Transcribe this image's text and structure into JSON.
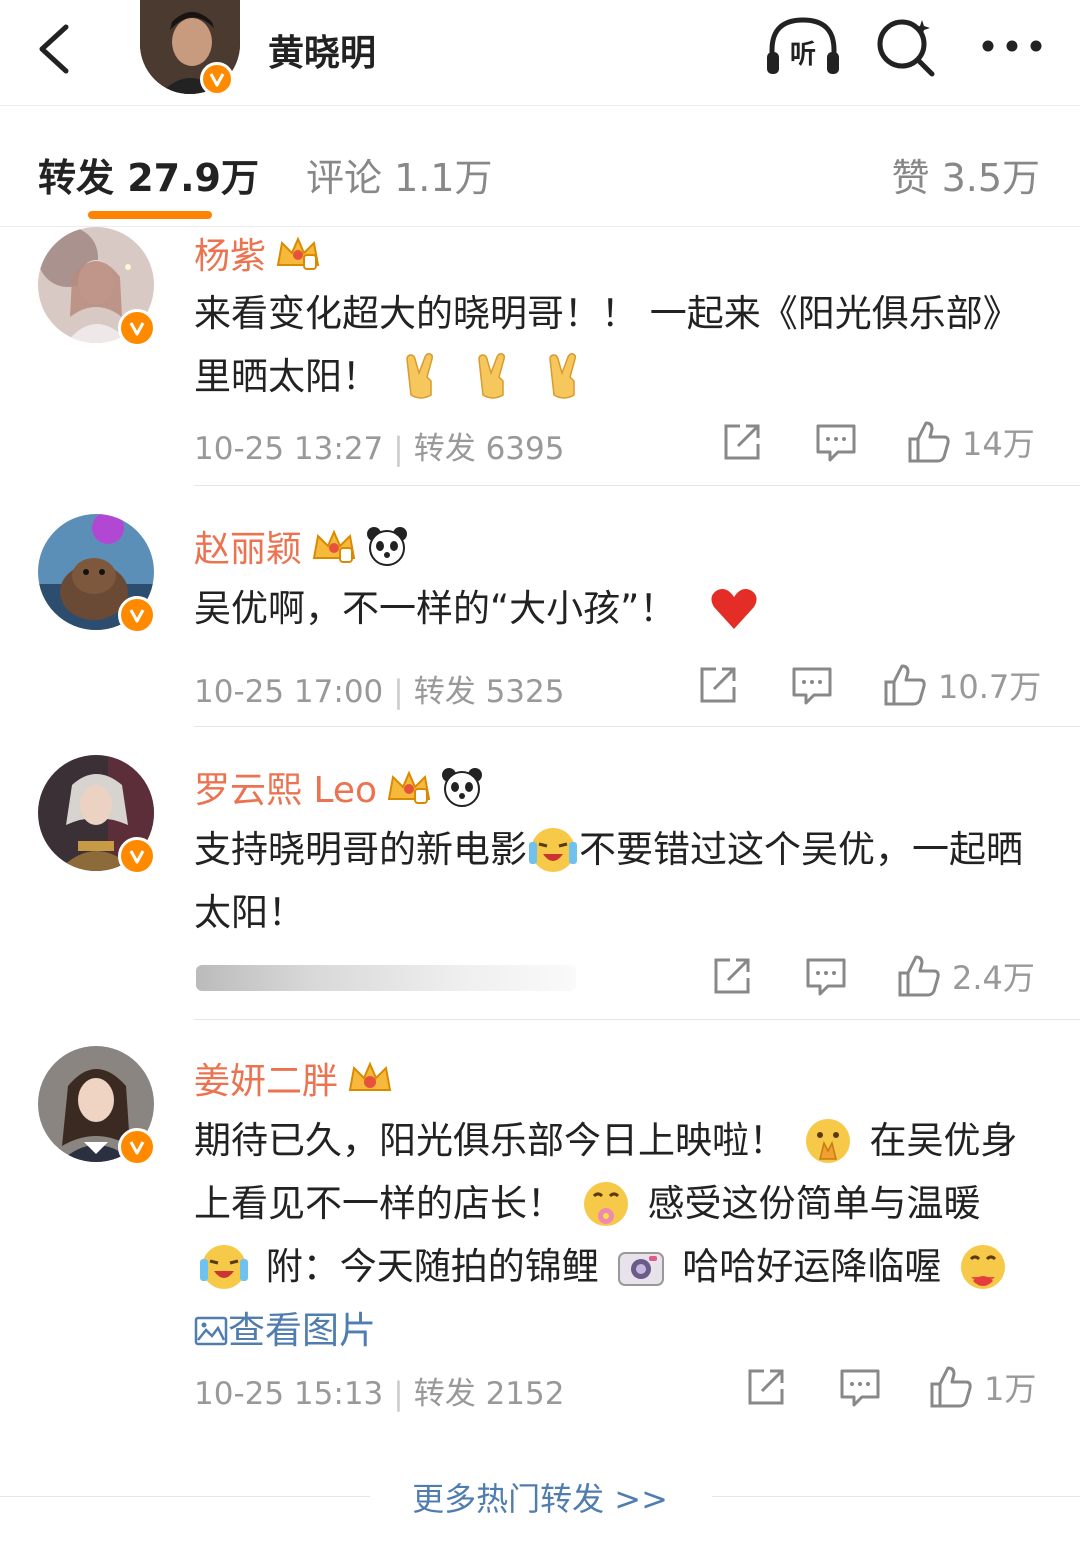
{
  "header": {
    "title": "黄晓明",
    "listen_label": "听"
  },
  "tabs": [
    {
      "label": "转发 27.9万"
    },
    {
      "label": "评论 1.1万"
    },
    {
      "label": "赞 3.5万"
    }
  ],
  "comments": [
    {
      "user": "杨紫",
      "text_parts": [
        "来看变化超大的晓明哥！！ 一起来《阳光俱乐部》里晒太阳！"
      ],
      "time": "10-25 13:27",
      "repost": "转发 6395",
      "likes": "14万"
    },
    {
      "user": "赵丽颖",
      "text_parts": [
        "吴优啊，不一样的“大小孩”！"
      ],
      "time": "10-25 17:00",
      "repost": "转发 5325",
      "likes": "10.7万"
    },
    {
      "user": "罗云熙 Leo",
      "text_parts": [
        "支持晓明哥的新电影",
        "不要错过这个吴优，一起晒太阳！"
      ],
      "likes": "2.4万"
    },
    {
      "user": "姜妍二胖",
      "text_parts": [
        "期待已久，阳光俱乐部今日上映啦！",
        "在吴优身上看见不一样的店长！",
        "感受这份简单与温暖",
        "附：今天随拍的锦鲤",
        "哈哈好运降临喔",
        "查看图片"
      ],
      "time": "10-25 15:13",
      "repost": "转发 2152",
      "likes": "1万"
    }
  ],
  "more_link": "更多热门转发 >>",
  "colors": {
    "accent": "#ff8200",
    "username": "#eb7350",
    "link": "#507daf",
    "verified_badge": "#ff8a00"
  }
}
